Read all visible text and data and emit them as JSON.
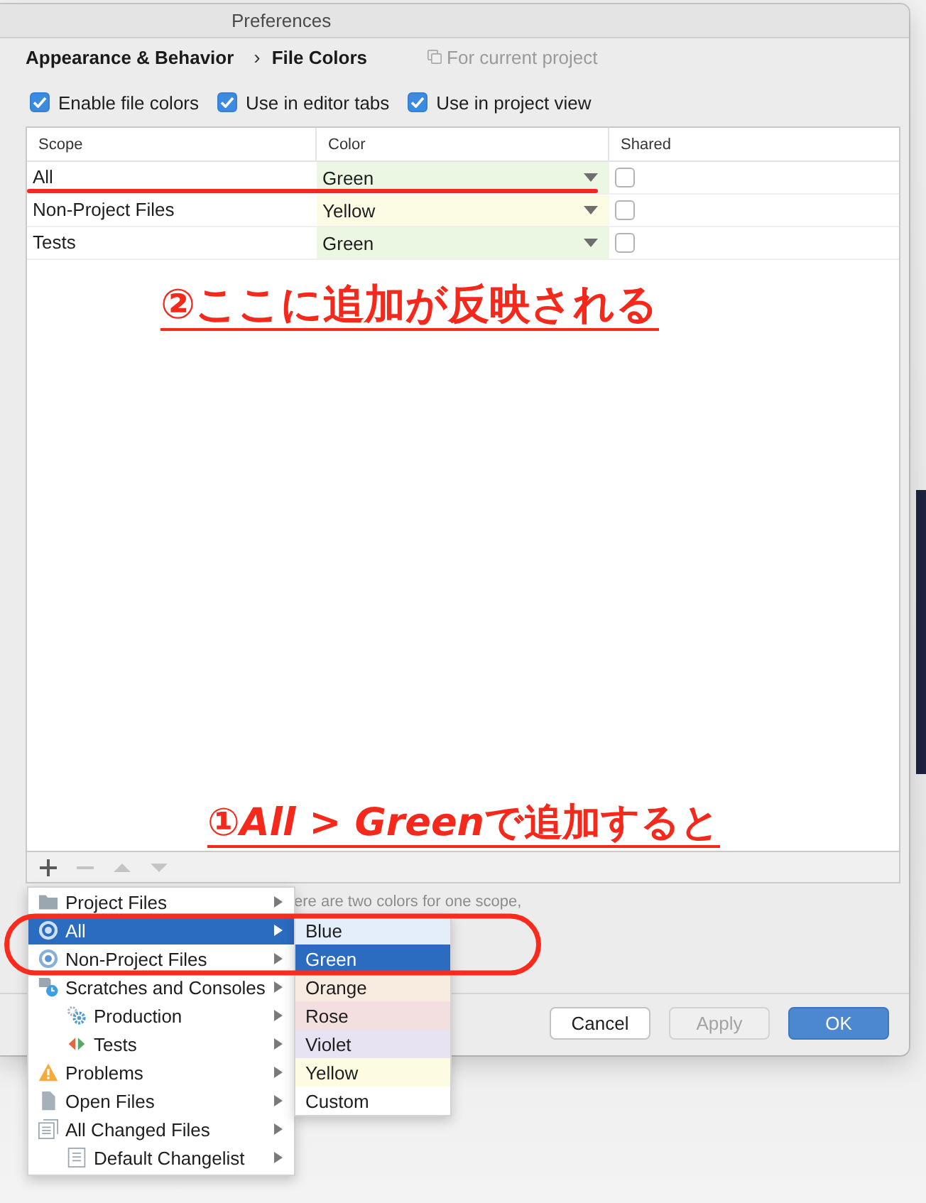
{
  "window": {
    "title": "Preferences"
  },
  "breadcrumb": {
    "parent": "Appearance & Behavior",
    "separator": "›",
    "current": "File Colors",
    "scope_note": "For current project"
  },
  "options": [
    {
      "label": "Enable file colors",
      "checked": true
    },
    {
      "label": "Use in editor tabs",
      "checked": true
    },
    {
      "label": "Use in project view",
      "checked": true
    }
  ],
  "table": {
    "columns": [
      "Scope",
      "Color",
      "Shared"
    ],
    "rows": [
      {
        "scope": "All",
        "color_name": "Green",
        "color": "#ebf6e3",
        "shared": false
      },
      {
        "scope": "Non-Project Files",
        "color_name": "Yellow",
        "color": "#fcfce4",
        "shared": false
      },
      {
        "scope": "Tests",
        "color_name": "Green",
        "color": "#ebf6e3",
        "shared": false
      }
    ]
  },
  "annotations": [
    {
      "parts": [
        {
          "text": "②ここに追加が反映される",
          "italic": false
        }
      ]
    },
    {
      "parts": [
        {
          "text": "①",
          "italic": false
        },
        {
          "text": "All > Green",
          "italic": true
        },
        {
          "text": "で追加すると",
          "italic": false
        }
      ]
    }
  ],
  "toolbar": [
    {
      "kind": "add",
      "disabled": false
    },
    {
      "kind": "remove",
      "disabled": true
    },
    {
      "kind": "up",
      "disabled": true
    },
    {
      "kind": "down",
      "disabled": true
    }
  ],
  "hint": "ere are two colors for one scope,",
  "buttons": [
    {
      "label": "Cancel",
      "disabled": false,
      "default": false
    },
    {
      "label": "Apply",
      "disabled": true,
      "default": false
    },
    {
      "label": "OK",
      "disabled": false,
      "default": true
    }
  ],
  "scope_menu": {
    "items": [
      {
        "label": "Project Files",
        "kind": "folder",
        "selected": false
      },
      {
        "label": "All",
        "kind": "scope",
        "selected": true
      },
      {
        "label": "Non-Project Files",
        "kind": "scope",
        "selected": false
      },
      {
        "label": "Scratches and Consoles",
        "kind": "scratches",
        "selected": false,
        "children": [
          {
            "label": "Production",
            "kind": "gear",
            "selected": false
          },
          {
            "label": "Tests",
            "kind": "tests",
            "selected": false
          }
        ]
      },
      {
        "label": "Problems",
        "kind": "warning",
        "selected": false
      },
      {
        "label": "Open Files",
        "kind": "file",
        "selected": false
      },
      {
        "label": "All Changed Files",
        "kind": "changes",
        "selected": false,
        "children": [
          {
            "label": "Default Changelist",
            "kind": "changelist",
            "selected": false
          }
        ]
      }
    ]
  },
  "color_menu": {
    "items": [
      {
        "label": "Blue",
        "color": "#e3eefa",
        "selected": false
      },
      {
        "label": "Green",
        "selected": true
      },
      {
        "label": "Orange",
        "color": "#f8ebe0",
        "selected": false
      },
      {
        "label": "Rose",
        "color": "#f3dfe0",
        "selected": false
      },
      {
        "label": "Violet",
        "color": "#e7e3f3",
        "selected": false
      },
      {
        "label": "Yellow",
        "color": "#fdfce2",
        "selected": false
      },
      {
        "label": "Custom",
        "color": "#ffffff",
        "selected": false
      }
    ]
  }
}
